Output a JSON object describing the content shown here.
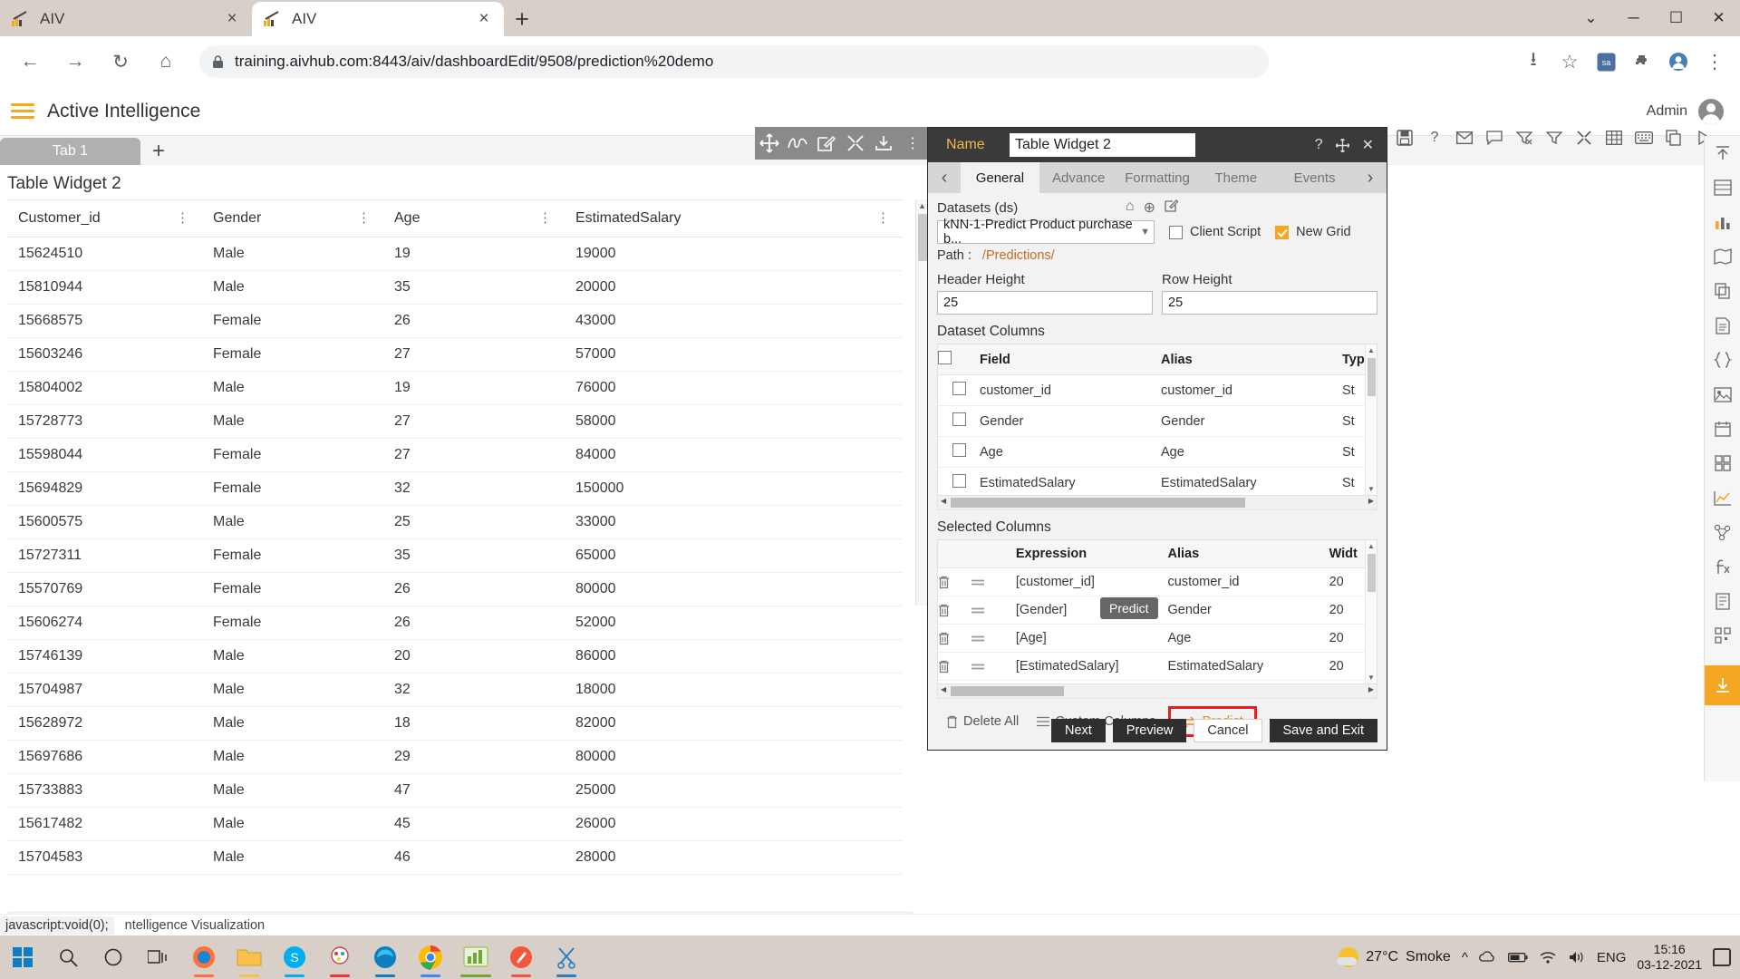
{
  "browser": {
    "tabs": [
      {
        "title": "AIV",
        "active": false,
        "close_label": "×"
      },
      {
        "title": "AIV",
        "active": true,
        "close_label": "×"
      }
    ],
    "new_tab_label": "+",
    "window_controls": {
      "minimize": "─",
      "maximize": "☐",
      "close": "✕",
      "chevron": "⌄"
    },
    "url": "training.aivhub.com:8443/aiv/dashboardEdit/9508/prediction%20demo",
    "url_host": "training.aivhub.com:8443",
    "url_path": "/aiv/dashboardEdit/9508/prediction%20demo"
  },
  "app_header": {
    "title": "Active Intelligence",
    "user": "Admin"
  },
  "dashboard": {
    "tab_label": "Tab 1",
    "add_tab_label": "+"
  },
  "widget": {
    "title": "Table Widget 2",
    "columns": [
      "Customer_id",
      "Gender",
      "Age",
      "EstimatedSalary"
    ],
    "rows": [
      [
        "15624510",
        "Male",
        "19",
        "19000"
      ],
      [
        "15810944",
        "Male",
        "35",
        "20000"
      ],
      [
        "15668575",
        "Female",
        "26",
        "43000"
      ],
      [
        "15603246",
        "Female",
        "27",
        "57000"
      ],
      [
        "15804002",
        "Male",
        "19",
        "76000"
      ],
      [
        "15728773",
        "Male",
        "27",
        "58000"
      ],
      [
        "15598044",
        "Female",
        "27",
        "84000"
      ],
      [
        "15694829",
        "Female",
        "32",
        "150000"
      ],
      [
        "15600575",
        "Male",
        "25",
        "33000"
      ],
      [
        "15727311",
        "Female",
        "35",
        "65000"
      ],
      [
        "15570769",
        "Female",
        "26",
        "80000"
      ],
      [
        "15606274",
        "Female",
        "26",
        "52000"
      ],
      [
        "15746139",
        "Male",
        "20",
        "86000"
      ],
      [
        "15704987",
        "Male",
        "32",
        "18000"
      ],
      [
        "15628972",
        "Male",
        "18",
        "82000"
      ],
      [
        "15697686",
        "Male",
        "29",
        "80000"
      ],
      [
        "15733883",
        "Male",
        "47",
        "25000"
      ],
      [
        "15617482",
        "Male",
        "45",
        "26000"
      ],
      [
        "15704583",
        "Male",
        "46",
        "28000"
      ]
    ]
  },
  "panel": {
    "name_label": "Name",
    "name_value": "Table Widget 2",
    "help_icon": "?",
    "tabs": [
      "General",
      "Advance",
      "Formatting",
      "Theme",
      "Events"
    ],
    "active_tab": "General",
    "datasets_label": "Datasets (ds)",
    "dataset_value": "kNN-1-Predict Product purchase b...",
    "client_script_label": "Client Script",
    "client_script_checked": false,
    "new_grid_label": "New Grid",
    "new_grid_checked": true,
    "path_label": "Path :",
    "path_value": "/Predictions/",
    "header_height_label": "Header Height",
    "header_height_value": "25",
    "row_height_label": "Row Height",
    "row_height_value": "25",
    "dataset_columns_title": "Dataset Columns",
    "dataset_columns_headers": [
      "Field",
      "Alias",
      "Type"
    ],
    "dataset_columns_rows": [
      {
        "field": "customer_id",
        "alias": "customer_id",
        "type": "St"
      },
      {
        "field": "Gender",
        "alias": "Gender",
        "type": "St"
      },
      {
        "field": "Age",
        "alias": "Age",
        "type": "St"
      },
      {
        "field": "EstimatedSalary",
        "alias": "EstimatedSalary",
        "type": "St"
      }
    ],
    "selected_columns_title": "Selected Columns",
    "selected_columns_headers": [
      "Expression",
      "Alias",
      "Widt"
    ],
    "selected_columns_rows": [
      {
        "expression": "[customer_id]",
        "alias": "customer_id",
        "width": "20"
      },
      {
        "expression": "[Gender]",
        "alias": "Gender",
        "width": "20"
      },
      {
        "expression": "[Age]",
        "alias": "Age",
        "width": "20"
      },
      {
        "expression": "[EstimatedSalary]",
        "alias": "EstimatedSalary",
        "width": "20"
      }
    ],
    "delete_all_label": "Delete All",
    "custom_columns_label": "Custom Columns",
    "predict_label": "Predict",
    "predict_tooltip": "Predict",
    "buttons": {
      "next": "Next",
      "preview": "Preview",
      "cancel": "Cancel",
      "save_and_exit": "Save and Exit"
    }
  },
  "statusbar": {
    "link_status": "javascript:void(0);",
    "visualization_text": "ntelligence Visualization"
  },
  "taskbar": {
    "weather_temp": "27°C",
    "weather_desc": "Smoke",
    "language": "ENG",
    "time": "15:16",
    "date": "03-12-2021"
  },
  "colors": {
    "accent_orange": "#f5a623",
    "predict_orange": "#e8892a",
    "highlight_red": "#ee1c1c",
    "panel_dark": "#3a3a3a"
  }
}
